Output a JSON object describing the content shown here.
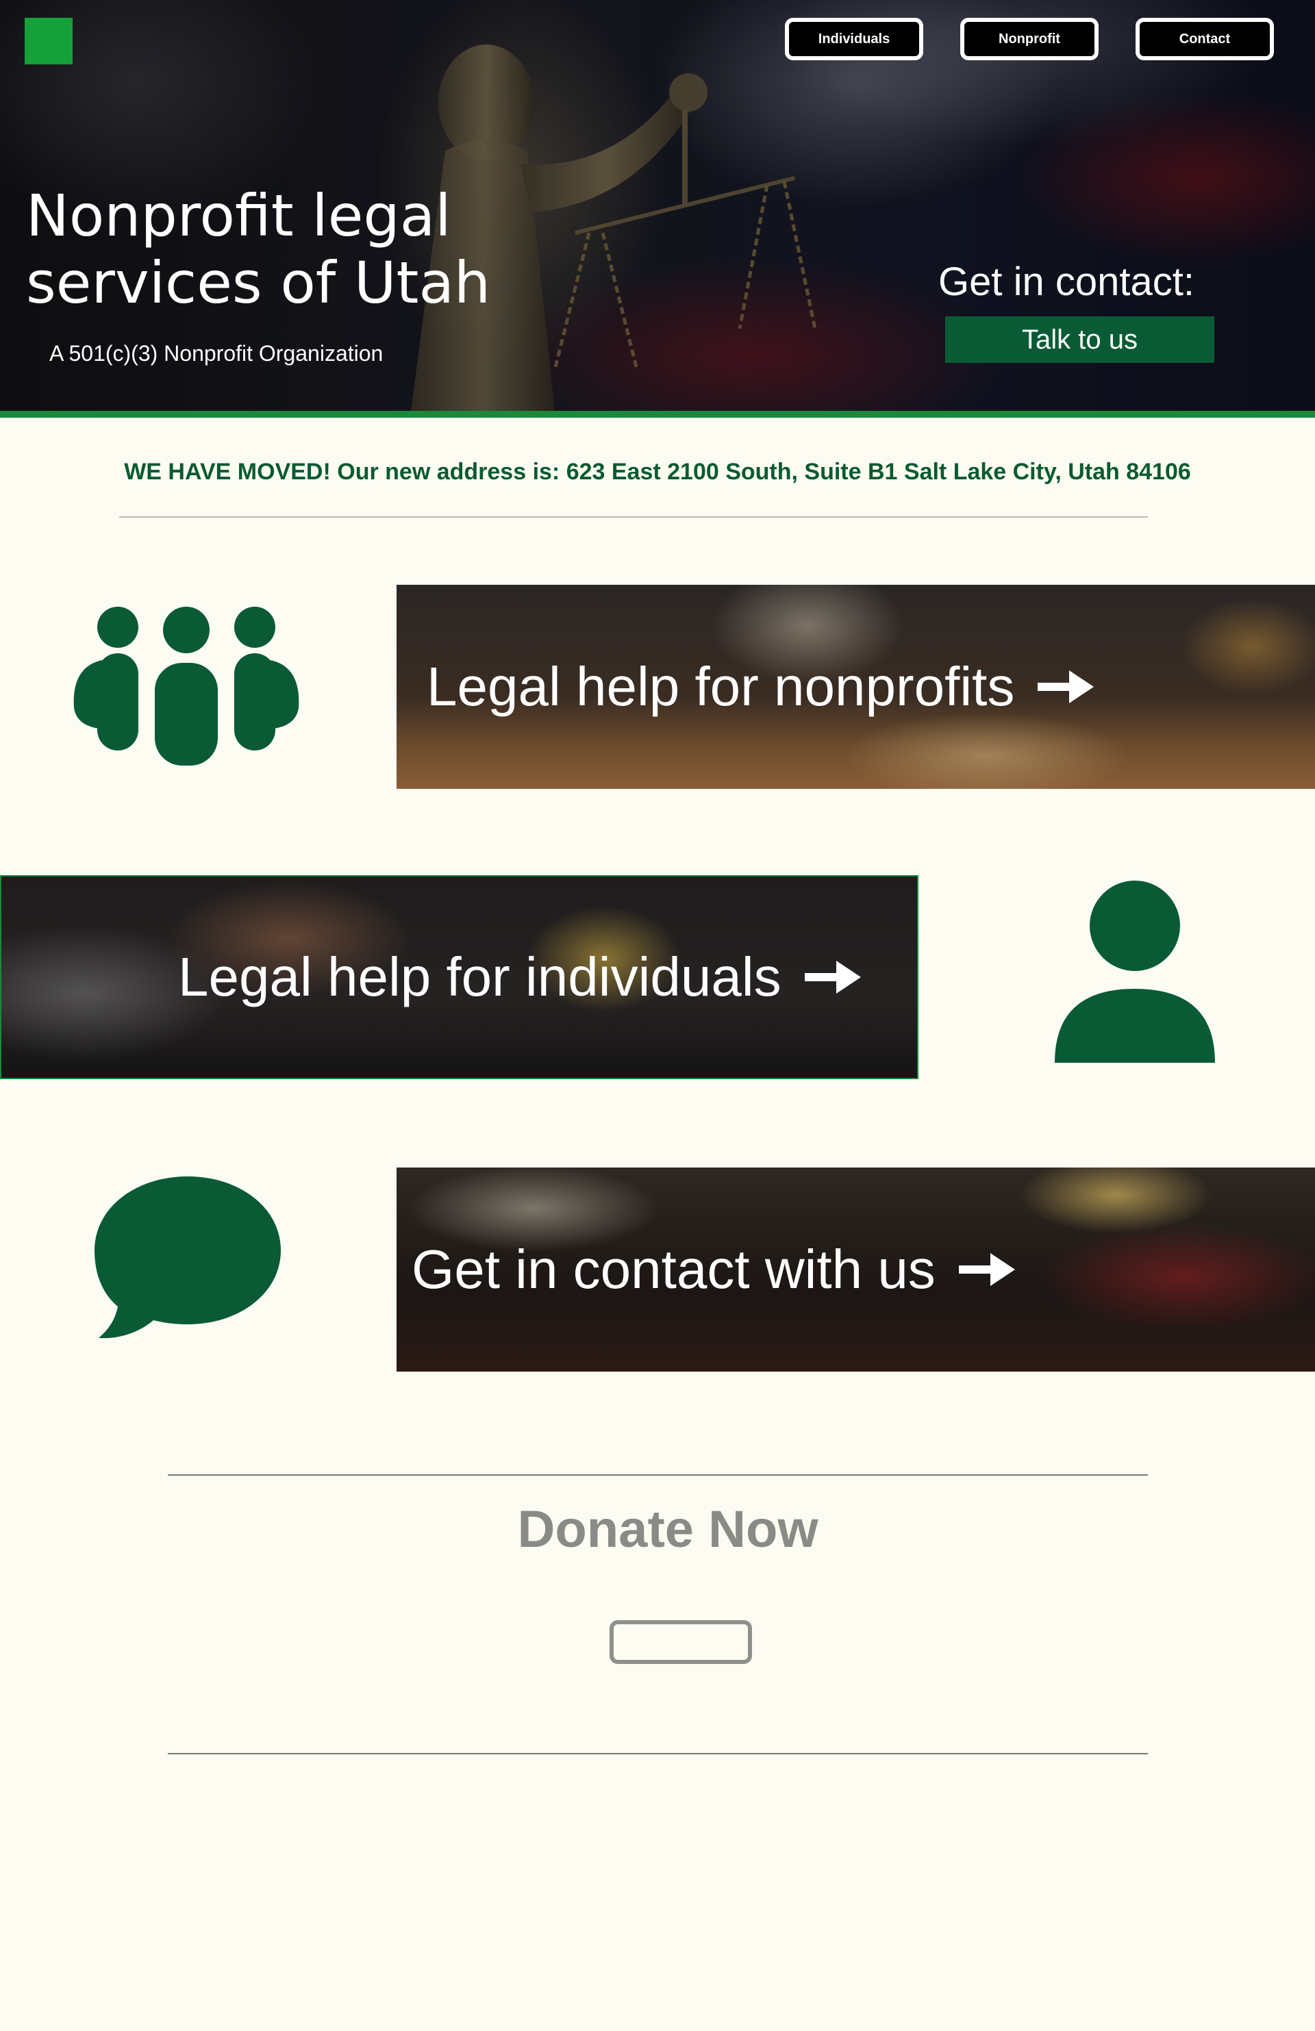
{
  "colors": {
    "brand_green": "#0a5b35",
    "logo_green": "#16a03a",
    "page_background": "#fcfcf3",
    "muted_gray": "#8a8a86"
  },
  "header": {
    "logo_icon": "green-square-logo",
    "nav": [
      {
        "label": "Individuals"
      },
      {
        "label": "Nonprofit"
      },
      {
        "label": "Contact"
      }
    ]
  },
  "hero": {
    "title": "Nonprofit legal services of Utah",
    "subtitle": "A 501(c)(3) Nonprofit Organization",
    "contact_heading": "Get in contact:",
    "contact_button": "Talk to us"
  },
  "notice": {
    "text": "WE HAVE MOVED! Our new address is: 623 East 2100 South, Suite B1 Salt Lake City, Utah 84106"
  },
  "services": [
    {
      "label": "Legal help for nonprofits",
      "icon": "group-people-icon",
      "arrow": "arrow-right-icon"
    },
    {
      "label": "Legal help for individuals",
      "icon": "person-icon",
      "arrow": "arrow-right-icon"
    },
    {
      "label": "Get in contact with us",
      "icon": "speech-bubble-icon",
      "arrow": "arrow-right-icon"
    }
  ],
  "donate": {
    "title": "Donate Now",
    "button_label": ""
  }
}
